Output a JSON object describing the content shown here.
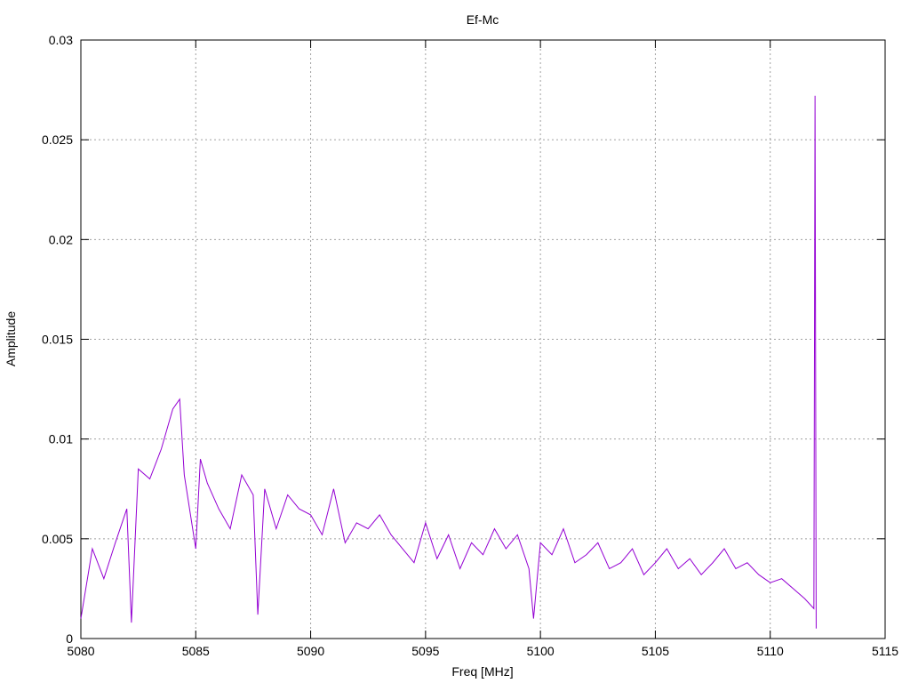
{
  "chart_data": {
    "type": "line",
    "title": "Ef-Mc",
    "xlabel": "Freq [MHz]",
    "ylabel": "Amplitude",
    "xlim": [
      5080,
      5115
    ],
    "ylim": [
      0,
      0.03
    ],
    "grid": true,
    "legend": "none",
    "x_ticks": [
      "5080",
      "5085",
      "5090",
      "5095",
      "5100",
      "5105",
      "5110",
      "5115"
    ],
    "y_ticks": [
      "0",
      "0.005",
      "0.01",
      "0.015",
      "0.02",
      "0.025",
      "0.03"
    ],
    "colors": {
      "series": "#9400d3",
      "grid": "#a0a0a0",
      "axes": "#000000"
    },
    "series": [
      {
        "x": [
          5080.0,
          5080.5,
          5081.0,
          5081.5,
          5082.0,
          5082.2,
          5082.5,
          5083.0,
          5083.5,
          5084.0,
          5084.3,
          5084.5,
          5085.0,
          5085.2,
          5085.5,
          5086.0,
          5086.5,
          5087.0,
          5087.5,
          5087.7,
          5088.0,
          5088.5,
          5089.0,
          5089.5,
          5090.0,
          5090.5,
          5091.0,
          5091.5,
          5092.0,
          5092.5,
          5093.0,
          5093.5,
          5094.0,
          5094.5,
          5095.0,
          5095.5,
          5096.0,
          5096.5,
          5097.0,
          5097.5,
          5098.0,
          5098.5,
          5099.0,
          5099.5,
          5099.7,
          5100.0,
          5100.5,
          5101.0,
          5101.5,
          5102.0,
          5102.5,
          5103.0,
          5103.5,
          5104.0,
          5104.5,
          5105.0,
          5105.5,
          5106.0,
          5106.5,
          5107.0,
          5107.5,
          5108.0,
          5108.5,
          5109.0,
          5109.5,
          5110.0,
          5110.5,
          5111.0,
          5111.5,
          5111.9,
          5111.95,
          5112.0
        ],
        "y": [
          0.001,
          0.0045,
          0.003,
          0.0048,
          0.0065,
          0.0008,
          0.0085,
          0.008,
          0.0095,
          0.0115,
          0.012,
          0.0082,
          0.0045,
          0.009,
          0.0078,
          0.0065,
          0.0055,
          0.0082,
          0.0072,
          0.0012,
          0.0075,
          0.0055,
          0.0072,
          0.0065,
          0.0062,
          0.0052,
          0.0075,
          0.0048,
          0.0058,
          0.0055,
          0.0062,
          0.0052,
          0.0045,
          0.0038,
          0.0058,
          0.004,
          0.0052,
          0.0035,
          0.0048,
          0.0042,
          0.0055,
          0.0045,
          0.0052,
          0.0035,
          0.001,
          0.0048,
          0.0042,
          0.0055,
          0.0038,
          0.0042,
          0.0048,
          0.0035,
          0.0038,
          0.0045,
          0.0032,
          0.0038,
          0.0045,
          0.0035,
          0.004,
          0.0032,
          0.0038,
          0.0045,
          0.0035,
          0.0038,
          0.0032,
          0.0028,
          0.003,
          0.0025,
          0.002,
          0.0015,
          0.0272,
          0.0005
        ]
      }
    ]
  }
}
